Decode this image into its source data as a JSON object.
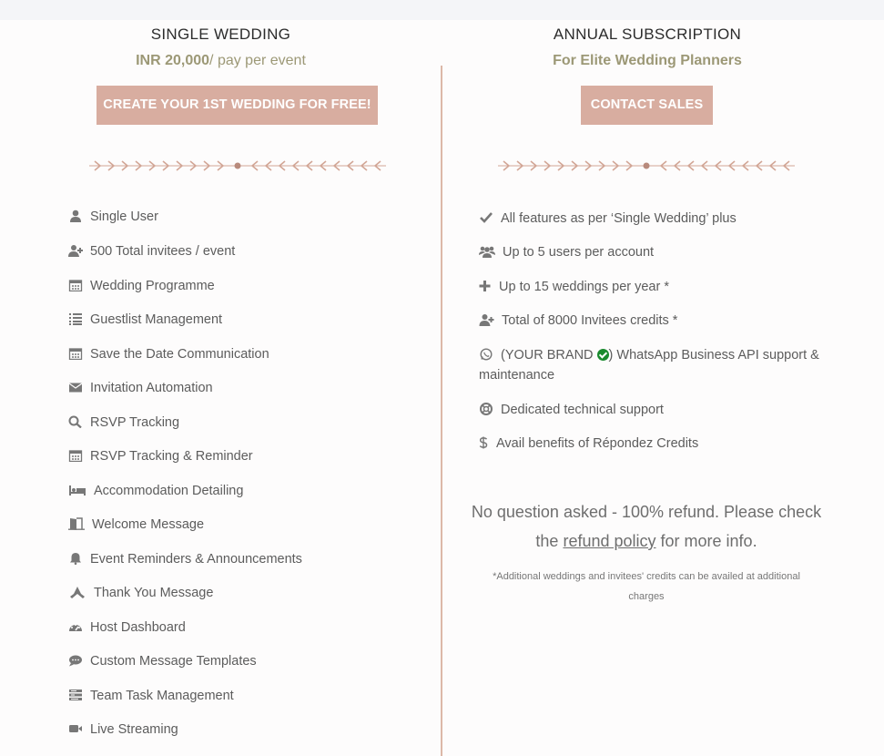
{
  "single": {
    "title": "SINGLE WEDDING",
    "price": "INR 20,000",
    "price_suffix": "/ pay per event",
    "cta": "CREATE YOUR 1ST WEDDING FOR FREE!",
    "features": [
      {
        "icon": "user-icon",
        "label": "Single User"
      },
      {
        "icon": "user-plus-icon",
        "label": "500 Total invitees / event"
      },
      {
        "icon": "calendar-icon",
        "label": "Wedding Programme"
      },
      {
        "icon": "list-icon",
        "label": "Guestlist Management"
      },
      {
        "icon": "calendar-icon",
        "label": "Save the Date Communication"
      },
      {
        "icon": "envelope-icon",
        "label": "Invitation Automation"
      },
      {
        "icon": "search-icon",
        "label": "RSVP Tracking"
      },
      {
        "icon": "calendar-icon",
        "label": "RSVP Tracking & Reminder"
      },
      {
        "icon": "bed-icon",
        "label": "Accommodation Detailing"
      },
      {
        "icon": "door-icon",
        "label": "Welcome Message"
      },
      {
        "icon": "bell-icon",
        "label": "Event Reminders & Announcements"
      },
      {
        "icon": "praying-hands-icon",
        "label": "Thank You Message"
      },
      {
        "icon": "dashboard-icon",
        "label": "Host Dashboard"
      },
      {
        "icon": "comment-icon",
        "label": "Custom Message Templates"
      },
      {
        "icon": "tasks-icon",
        "label": "Team Task Management"
      },
      {
        "icon": "video-icon",
        "label": "Live Streaming"
      }
    ]
  },
  "annual": {
    "title": "ANNUAL SUBSCRIPTION",
    "subtitle": "For Elite Wedding Planners",
    "cta": "CONTACT SALES",
    "features": [
      {
        "icon": "check-icon",
        "label": "All features as per ‘Single Wedding’ plus"
      },
      {
        "icon": "users-icon",
        "label": "Up to 5 users per account"
      },
      {
        "icon": "plus-icon",
        "label": "Up to 15 weddings per year *"
      },
      {
        "icon": "user-plus-icon",
        "label": "Total of 8000 Invitees credits *"
      },
      {
        "icon": "whatsapp-icon",
        "label_before": "(YOUR BRAND",
        "label_after": ") WhatsApp Business API support & maintenance"
      },
      {
        "icon": "lifebuoy-icon",
        "label": "Dedicated technical support"
      },
      {
        "icon": "dollar-icon",
        "label": "Avail benefits of Répondez Credits"
      }
    ],
    "refund_text_1": "No question asked - 100% refund. Please check the",
    "refund_link": "refund policy",
    "refund_text_2": "for more info.",
    "footnote": "*Additional weddings and invitees' credits can be availed at additional charges"
  },
  "colors": {
    "accent": "#d8ada0",
    "subtitle": "#9c9876",
    "divider": "#dcb8a8",
    "verified_badge": "#1a8a2e"
  }
}
